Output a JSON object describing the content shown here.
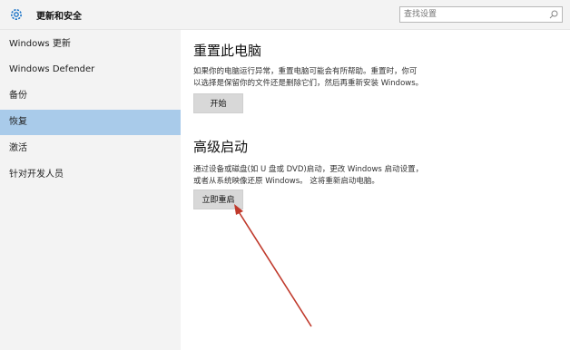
{
  "header": {
    "title": "更新和安全",
    "search_placeholder": "查找设置"
  },
  "sidebar": {
    "items": [
      {
        "label": "Windows 更新"
      },
      {
        "label": "Windows Defender"
      },
      {
        "label": "备份"
      },
      {
        "label": "恢复",
        "selected": true
      },
      {
        "label": "激活"
      },
      {
        "label": "针对开发人员"
      }
    ]
  },
  "main": {
    "reset": {
      "title": "重置此电脑",
      "desc_line1": "如果你的电脑运行异常，重置电脑可能会有所帮助。重置时，你可",
      "desc_line2": "以选择是保留你的文件还是删除它们，然后再重新安装 Windows。",
      "button": "开始"
    },
    "advanced": {
      "title": "高级启动",
      "desc_line1": "通过设备或磁盘(如 U 盘或 DVD)启动，更改 Windows 启动设置，",
      "desc_line2": "或者从系统映像还原 Windows。 这将重新启动电脑。",
      "button": "立即重启"
    }
  },
  "colors": {
    "selected_bg": "#a9cbea",
    "sidebar_bg": "#f3f3f3",
    "annotation_arrow": "#c0392b"
  }
}
